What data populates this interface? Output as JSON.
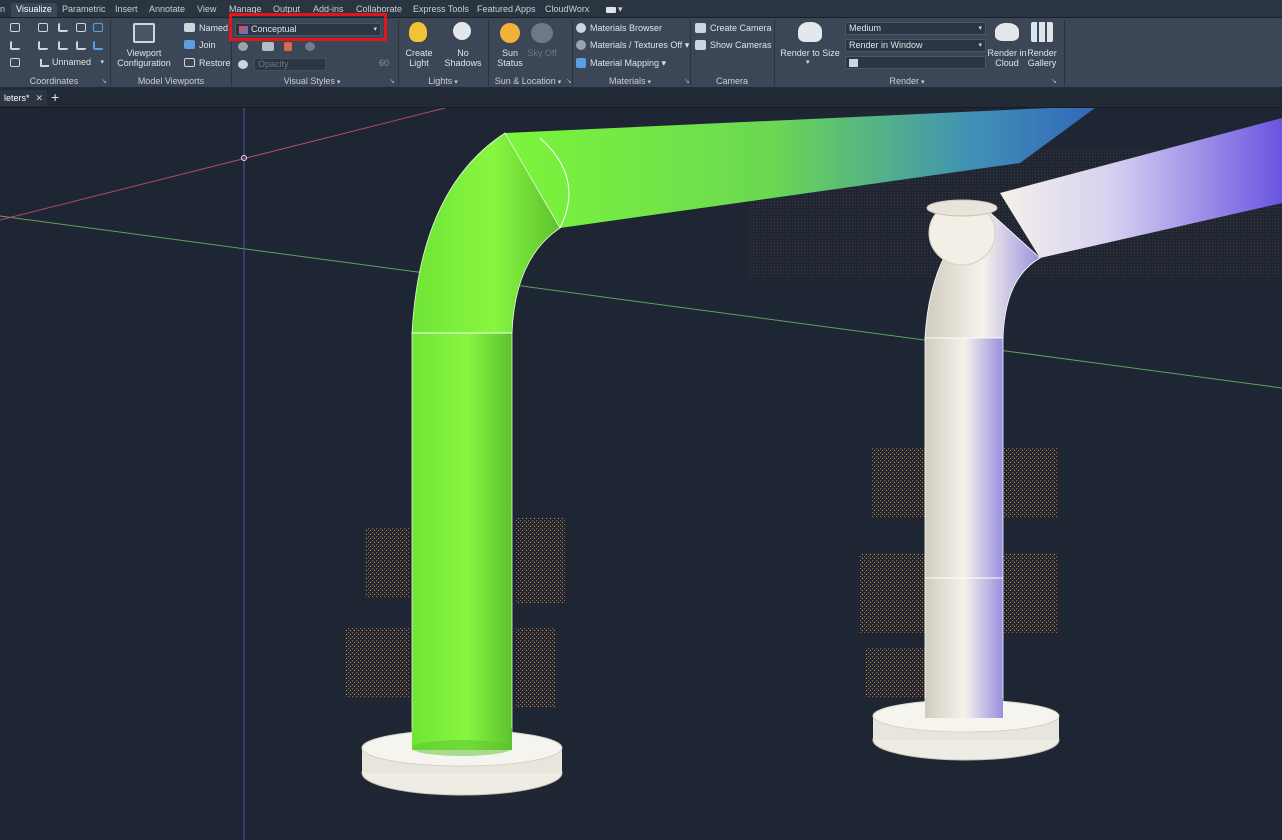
{
  "tabs": [
    {
      "label": "Visualize",
      "active": true
    },
    {
      "label": "Parametric"
    },
    {
      "label": "Insert"
    },
    {
      "label": "Annotate"
    },
    {
      "label": "View"
    },
    {
      "label": "Manage"
    },
    {
      "label": "Output"
    },
    {
      "label": "Add-ins"
    },
    {
      "label": "Collaborate"
    },
    {
      "label": "Express Tools"
    },
    {
      "label": "Featured Apps"
    },
    {
      "label": "CloudWorx"
    }
  ],
  "coordinates": {
    "title": "Coordinates",
    "ucs_dropdown": "Unnamed"
  },
  "model_viewports": {
    "title": "Model Viewports",
    "viewport_config_line1": "Viewport",
    "viewport_config_line2": "Configuration",
    "named": "Named",
    "join": "Join",
    "restore": "Restore"
  },
  "visual_styles": {
    "title": "Visual Styles",
    "current_style": "Conceptual",
    "opacity_placeholder": "Opacity",
    "opacity_value": "60"
  },
  "lights": {
    "title": "Lights",
    "create_light_line1": "Create",
    "create_light_line2": "Light",
    "no_shadows_line1": "No",
    "no_shadows_line2": "Shadows"
  },
  "sun_location": {
    "title": "Sun & Location",
    "sun_status_line1": "Sun",
    "sun_status_line2": "Status",
    "sky_off": "Sky Off"
  },
  "materials": {
    "title": "Materials",
    "browser": "Materials Browser",
    "textures": "Materials / Textures Off",
    "mapping": "Material Mapping"
  },
  "camera": {
    "title": "Camera",
    "create_camera": "Create Camera",
    "show_cameras": "Show Cameras"
  },
  "render": {
    "title": "Render",
    "render_to_size": "Render to Size",
    "quality": "Medium",
    "render_target": "Render in Window",
    "cloud_line1": "Render in",
    "cloud_line2": "Cloud",
    "gallery_line1": "Render",
    "gallery_line2": "Gallery"
  },
  "file_tab": {
    "label": "leters*"
  },
  "colors": {
    "highlight": "#e0161b",
    "pipe_green": "#7cf53a",
    "pipe_white": "#f2efe6",
    "viewport_bg": "#1e2633"
  }
}
